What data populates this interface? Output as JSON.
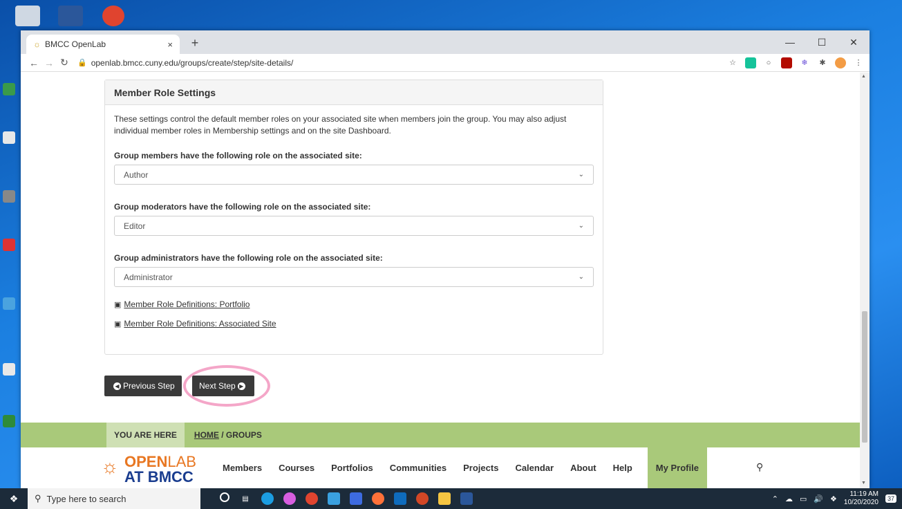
{
  "browser": {
    "tab_title": "BMCC OpenLab",
    "url": "openlab.bmcc.cuny.edu/groups/create/step/site-details/"
  },
  "panel": {
    "title": "Member Role Settings",
    "description": "These settings control the default member roles on your associated site when members join the group. You may also adjust individual member roles in Membership settings and on the site Dashboard.",
    "fields": [
      {
        "label": "Group members have the following role on the associated site:",
        "value": "Author"
      },
      {
        "label": "Group moderators have the following role on the associated site:",
        "value": "Editor"
      },
      {
        "label": "Group administrators have the following role on the associated site:",
        "value": "Administrator"
      }
    ],
    "links": [
      "Member Role Definitions: Portfolio",
      "Member Role Definitions: Associated Site"
    ]
  },
  "buttons": {
    "previous": "Previous Step",
    "next": "Next Step"
  },
  "breadcrumb": {
    "here": "YOU ARE HERE",
    "home": "HOME",
    "sep": " / ",
    "current": "GROUPS"
  },
  "logo": {
    "line1a": "OPEN",
    "line1b": "LAB",
    "line2": "AT BMCC"
  },
  "nav": [
    "Members",
    "Courses",
    "Portfolios",
    "Communities",
    "Projects",
    "Calendar",
    "About",
    "Help"
  ],
  "nav_active": "My Profile",
  "taskbar": {
    "search_placeholder": "Type here to search",
    "time": "11:19 AM",
    "date": "10/20/2020",
    "notifications": "37"
  }
}
